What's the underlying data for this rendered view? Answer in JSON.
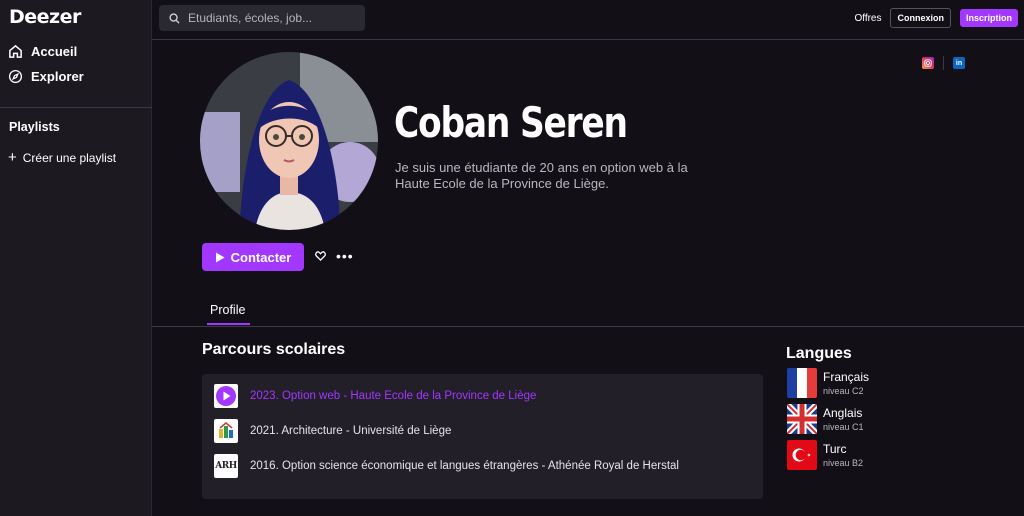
{
  "app": {
    "logo": "Deezer"
  },
  "sidebar": {
    "nav": [
      {
        "label": "Accueil",
        "icon": "home-icon"
      },
      {
        "label": "Explorer",
        "icon": "compass-icon"
      }
    ],
    "playlists_title": "Playlists",
    "create_playlist": "Créer une playlist"
  },
  "topbar": {
    "search_placeholder": "Etudiants, écoles, job...",
    "offres": "Offres",
    "connexion": "Connexion",
    "inscription": "Inscription"
  },
  "profile": {
    "name": "Coban Seren",
    "bio": "Je suis une étudiante de 20 ans en option web à la Haute Ecole de la Province de Liège.",
    "contact_label": "Contacter",
    "social": [
      {
        "icon": "instagram-icon"
      },
      {
        "icon": "linkedin-icon",
        "text": "in"
      }
    ]
  },
  "tabs": [
    {
      "label": "Profile",
      "active": true
    }
  ],
  "education": {
    "title": "Parcours scolaires",
    "items": [
      {
        "text": "2023. Option web - Haute Ecole de la Province de Liège",
        "active": true,
        "logo": "play-logo"
      },
      {
        "text": "2021. Architecture - Université de Liège",
        "active": false,
        "logo": "uliege-logo"
      },
      {
        "text": "2016. Option science économique et langues étrangères - Athénée Royal de Herstal",
        "active": false,
        "logo": "arh-logo",
        "logo_text": "ARH"
      }
    ]
  },
  "languages": {
    "title": "Langues",
    "items": [
      {
        "name": "Français",
        "level": "niveau C2",
        "flag": "france-flag"
      },
      {
        "name": "Anglais",
        "level": "niveau C1",
        "flag": "uk-flag"
      },
      {
        "name": "Turc",
        "level": "niveau B2",
        "flag": "turkey-flag"
      }
    ]
  },
  "colors": {
    "accent": "#a238ff",
    "background": "#121016",
    "sidebar": "#1c1a20",
    "card": "#221f28"
  }
}
